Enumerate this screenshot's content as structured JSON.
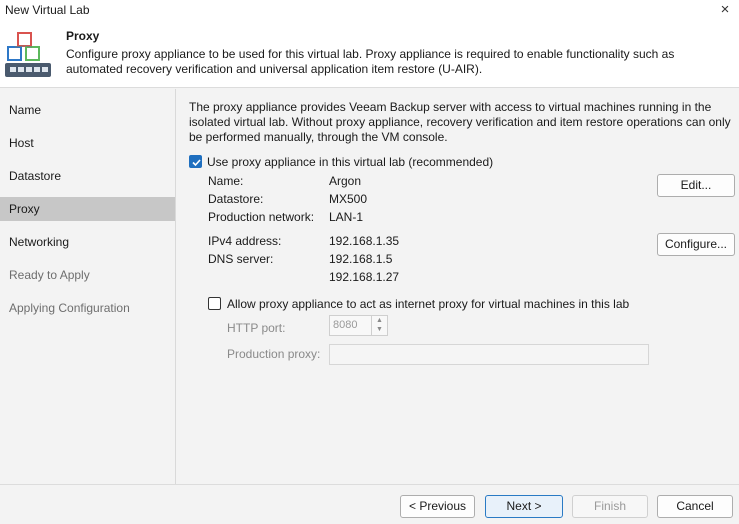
{
  "window": {
    "title": "New Virtual Lab",
    "close_icon": "×"
  },
  "header": {
    "title": "Proxy",
    "description": "Configure proxy appliance to be used for this virtual lab. Proxy appliance is required to enable functionality such as automated recovery verification and universal application item restore (U-AIR)."
  },
  "sidebar": {
    "items": [
      {
        "label": "Name",
        "state": "normal"
      },
      {
        "label": "Host",
        "state": "normal"
      },
      {
        "label": "Datastore",
        "state": "normal"
      },
      {
        "label": "Proxy",
        "state": "active"
      },
      {
        "label": "Networking",
        "state": "normal"
      },
      {
        "label": "Ready to Apply",
        "state": "disabled"
      },
      {
        "label": "Applying Configuration",
        "state": "disabled"
      }
    ]
  },
  "main": {
    "intro": "The proxy appliance provides Veeam Backup server with access to virtual machines running in the isolated virtual lab. Without proxy appliance, recovery verification and item restore operations can only be performed manually, through the VM console.",
    "use_proxy": {
      "label": "Use proxy appliance in this virtual lab (recommended)",
      "checked": true
    },
    "name_label": "Name:",
    "name_value": "Argon",
    "datastore_label": "Datastore:",
    "datastore_value": "MX500",
    "network_label": "Production network:",
    "network_value": "LAN-1",
    "ipv4_label": "IPv4 address:",
    "ipv4_value": "192.168.1.35",
    "dns_label": "DNS server:",
    "dns_values": [
      "192.168.1.5",
      "192.168.1.27"
    ],
    "edit_button": "Edit...",
    "configure_button": "Configure...",
    "internet_proxy": {
      "label": "Allow proxy appliance to act as internet proxy for virtual machines in this lab",
      "checked": false
    },
    "http_port_label": "HTTP port:",
    "http_port_value": "8080",
    "production_proxy_label": "Production proxy:",
    "production_proxy_value": ""
  },
  "footer": {
    "previous": "< Previous",
    "next": "Next >",
    "finish": "Finish",
    "cancel": "Cancel"
  },
  "colors": {
    "accent": "#1f6fbf",
    "active_nav": "#c7c7c7"
  }
}
